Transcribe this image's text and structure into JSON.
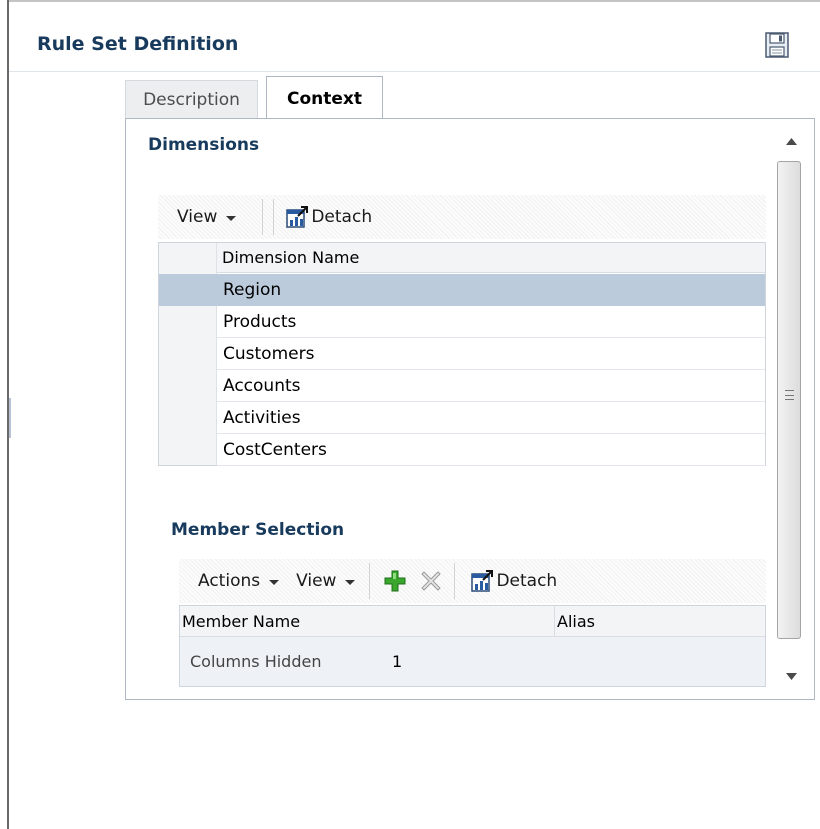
{
  "panel": {
    "title": "Rule Set Definition",
    "save_icon": "save-icon"
  },
  "tabs": [
    {
      "label": "Description",
      "selected": false
    },
    {
      "label": "Context",
      "selected": true
    }
  ],
  "dimensions": {
    "heading": "Dimensions",
    "toolbar": {
      "view_label": "View",
      "detach_label": "Detach"
    },
    "column_header": "Dimension Name",
    "rows": [
      "Region",
      "Products",
      "Customers",
      "Accounts",
      "Activities",
      "CostCenters"
    ],
    "selected_row": "Region"
  },
  "member_selection": {
    "heading": "Member Selection",
    "toolbar": {
      "actions_label": "Actions",
      "view_label": "View",
      "add_icon": "add-icon",
      "delete_icon": "delete-icon",
      "detach_label": "Detach"
    },
    "columns": [
      "Member Name",
      "Alias"
    ],
    "columns_hidden_label": "Columns Hidden",
    "columns_hidden_count": "1"
  },
  "colors": {
    "heading": "#183a5c",
    "selected_row": "#bccbdc",
    "add_icon": "#3aa62d"
  }
}
